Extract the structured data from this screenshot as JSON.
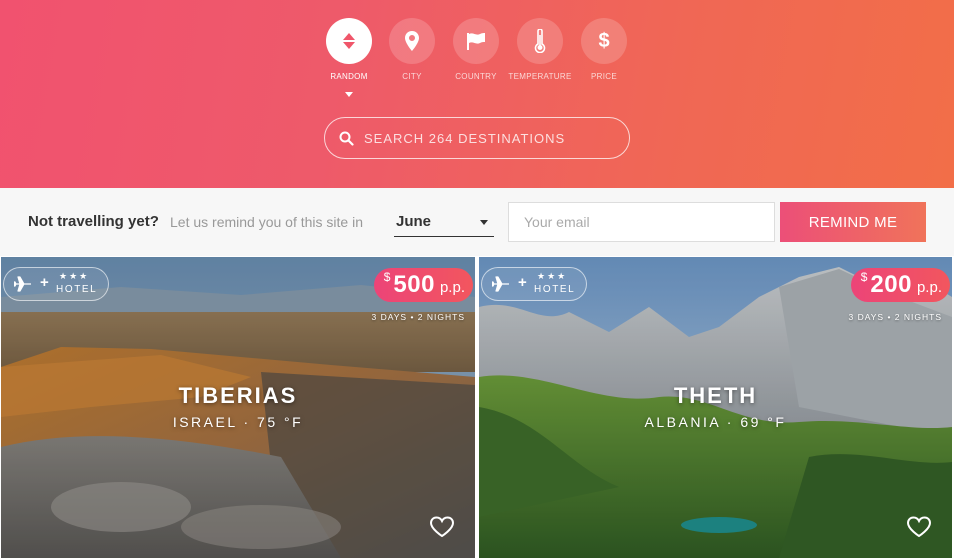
{
  "sort_options": [
    {
      "label": "RANDOM",
      "icon": "sort-arrows-icon",
      "active": true
    },
    {
      "label": "CITY",
      "icon": "map-pin-icon",
      "active": false
    },
    {
      "label": "COUNTRY",
      "icon": "flag-icon",
      "active": false
    },
    {
      "label": "TEMPERATURE",
      "icon": "thermometer-icon",
      "active": false
    },
    {
      "label": "PRICE",
      "icon": "dollar-icon",
      "active": false
    }
  ],
  "search": {
    "placeholder": "SEARCH 264 DESTINATIONS"
  },
  "reminder": {
    "question": "Not travelling yet?",
    "hint": "Let us remind you of this site in",
    "month": "June",
    "email_placeholder": "Your email",
    "button_label": "REMIND ME"
  },
  "destinations": [
    {
      "package_plus": "+",
      "package_stars": "★★★",
      "package_label": "HOTEL",
      "currency": "$",
      "price": "500",
      "per": "p.p.",
      "duration": "3 DAYS • 2 NIGHTS",
      "city": "TIBERIAS",
      "details": "ISRAEL · 75 °F"
    },
    {
      "package_plus": "+",
      "package_stars": "★★★",
      "package_label": "HOTEL",
      "currency": "$",
      "price": "200",
      "per": "p.p.",
      "duration": "3 DAYS • 2 NIGHTS",
      "city": "THETH",
      "details": "ALBANIA · 69 °F"
    }
  ],
  "colors": {
    "brand_pink": "#ec4f78",
    "brand_orange": "#f2704a"
  }
}
